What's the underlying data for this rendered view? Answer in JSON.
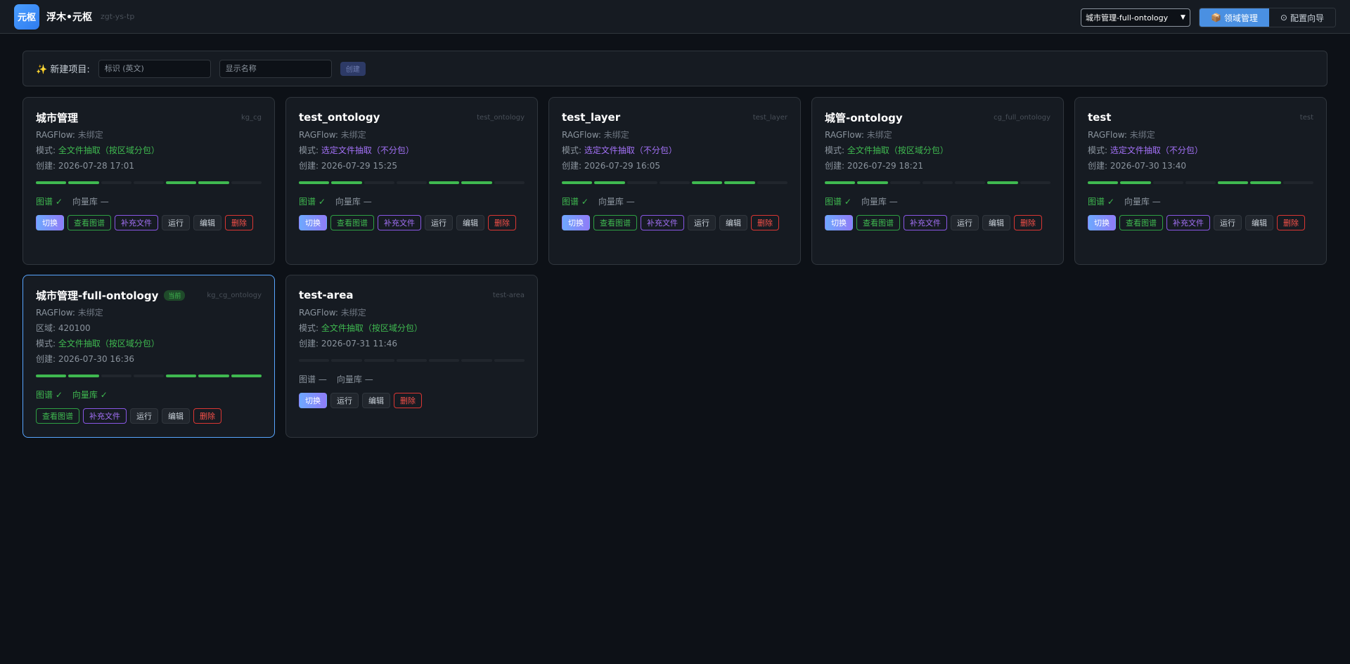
{
  "header": {
    "logo": "元枢",
    "brand": "浮木•元枢",
    "slug": "zgt-ys-tp",
    "project_select": "城市管理-full-ontology",
    "nav": [
      {
        "label": "领域管理",
        "icon": "📦"
      },
      {
        "label": "配置向导",
        "icon": "⊙"
      }
    ]
  },
  "newbar": {
    "label": "✨ 新建项目:",
    "id_placeholder": "标识 (英文)",
    "name_placeholder": "显示名称",
    "create": "创建"
  },
  "labels": {
    "ragflow": "RAGFlow: ",
    "mode": "模式: ",
    "created": "创建: ",
    "region": "区域: ",
    "graph": "图谱",
    "vector": "向量库",
    "ok_mark": "✓",
    "none_mark": "—",
    "current": "当前"
  },
  "buttons": {
    "switch": "切换",
    "view": "查看图谱",
    "supplement": "补充文件",
    "run": "运行",
    "edit": "编辑",
    "delete": "删除"
  },
  "cards": [
    {
      "title": "城市管理",
      "key": "kg_cg",
      "ragflow": "未绑定",
      "mode": "全文件抽取（按区域分包）",
      "mode_color": "green",
      "created": "2026-07-28 17:01",
      "progress": [
        1,
        1,
        0,
        0,
        1,
        1,
        0
      ],
      "graph": true,
      "vector": false
    },
    {
      "title": "test_ontology",
      "key": "test_ontology",
      "ragflow": "未绑定",
      "mode": "选定文件抽取（不分包）",
      "mode_color": "purple",
      "created": "2026-07-29 15:25",
      "progress": [
        1,
        1,
        0,
        0,
        1,
        1,
        0
      ],
      "graph": true,
      "vector": false
    },
    {
      "title": "test_layer",
      "key": "test_layer",
      "ragflow": "未绑定",
      "mode": "选定文件抽取（不分包）",
      "mode_color": "purple",
      "created": "2026-07-29 16:05",
      "progress": [
        1,
        1,
        0,
        0,
        1,
        1,
        0
      ],
      "graph": true,
      "vector": false
    },
    {
      "title": "城管-ontology",
      "key": "cg_full_ontology",
      "ragflow": "未绑定",
      "mode": "全文件抽取（按区域分包）",
      "mode_color": "green",
      "created": "2026-07-29 18:21",
      "progress": [
        1,
        1,
        0,
        0,
        0,
        1,
        0
      ],
      "graph": true,
      "vector": false
    },
    {
      "title": "test",
      "key": "test",
      "ragflow": "未绑定",
      "mode": "选定文件抽取（不分包）",
      "mode_color": "purple",
      "created": "2026-07-30 13:40",
      "progress": [
        1,
        1,
        0,
        0,
        1,
        1,
        0
      ],
      "graph": true,
      "vector": false
    },
    {
      "title": "城市管理-full-ontology",
      "key": "kg_cg_ontology",
      "ragflow": "未绑定",
      "region": "420100",
      "mode": "全文件抽取（按区域分包）",
      "mode_color": "green",
      "created": "2026-07-30 16:36",
      "progress": [
        1,
        1,
        0,
        0,
        1,
        1,
        1
      ],
      "graph": true,
      "vector": true,
      "current": true
    },
    {
      "title": "test-area",
      "key": "test-area",
      "ragflow": "未绑定",
      "mode": "全文件抽取（按区域分包）",
      "mode_color": "green",
      "created": "2026-07-31 11:46",
      "progress": [
        0,
        0,
        0,
        0,
        0,
        0,
        0
      ],
      "graph": false,
      "vector": false,
      "minimal": true
    }
  ]
}
